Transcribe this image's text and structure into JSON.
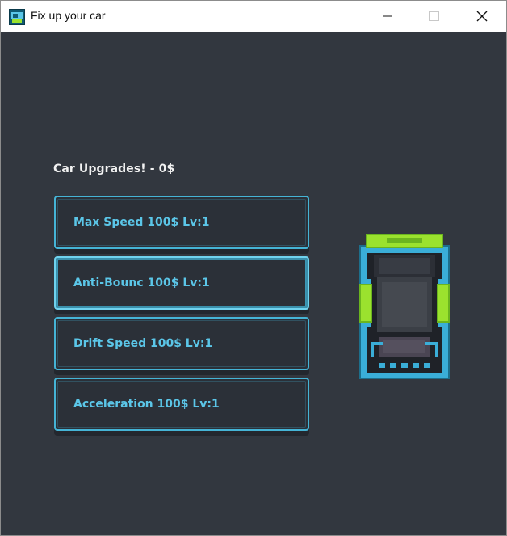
{
  "window": {
    "title": "Fix up your car",
    "icon": "game-app-icon"
  },
  "heading": "Car Upgrades! - 0$",
  "upgrades": [
    {
      "label": "Max Speed 100$ Lv:1"
    },
    {
      "label": "Anti-Bounc 100$ Lv:1"
    },
    {
      "label": "Drift Speed 100$ Lv:1"
    },
    {
      "label": "Acceleration 100$ Lv:1"
    }
  ],
  "colors": {
    "background": "#32373f",
    "button_border": "#45b4d6",
    "button_text": "#5bc6e8",
    "car_accent": "#9be22e",
    "car_body": "#3aaed8"
  }
}
